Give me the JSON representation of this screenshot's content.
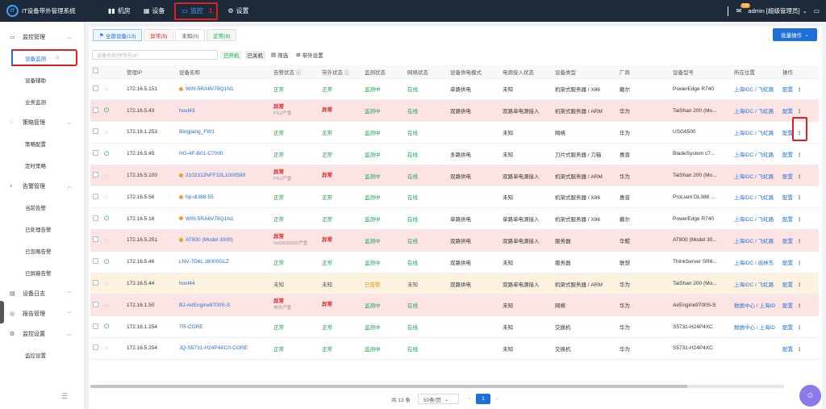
{
  "app": {
    "title": "IT设备带外管理系统",
    "logo_text": "IT"
  },
  "topnav": [
    {
      "label": "机房",
      "icon": "signal-bars-icon"
    },
    {
      "label": "设备",
      "icon": "grid-icon"
    },
    {
      "label": "监控",
      "icon": "monitor-icon",
      "active": true,
      "badge": "1"
    },
    {
      "label": "设置",
      "icon": "gear-icon"
    }
  ],
  "user": {
    "msg_count": "136",
    "name": "admin [超级管理员]"
  },
  "sidebar": {
    "groups": [
      {
        "label": "监控管理",
        "icon": "monitor-icon",
        "items": [
          {
            "label": "设备监测",
            "selected": true
          },
          {
            "label": "设备辅助"
          },
          {
            "label": "业务监测"
          }
        ]
      },
      {
        "label": "策略管理",
        "icon": "bulb-icon",
        "items": [
          {
            "label": "策略配置"
          },
          {
            "label": "定时策略"
          }
        ]
      },
      {
        "label": "告警管理",
        "icon": "bell-icon",
        "items": [
          {
            "label": "当前告警"
          },
          {
            "label": "已处理告警"
          },
          {
            "label": "已忽略告警"
          },
          {
            "label": "已屏蔽告警"
          }
        ]
      },
      {
        "label": "设备日志",
        "icon": "log-icon",
        "items": []
      },
      {
        "label": "报告管理",
        "icon": "report-icon",
        "items": []
      },
      {
        "label": "监控设置",
        "icon": "gear-icon",
        "items": [
          {
            "label": "监控设置"
          }
        ]
      }
    ]
  },
  "tabs": {
    "all": "全部设备(13)",
    "err": "异常(5)",
    "unk": "未知(0)",
    "ok": "正常(8)"
  },
  "batch_label": "批量操作",
  "filters": {
    "search_placeholder": "设备名称/序列号/IP",
    "on": "已开机",
    "off": "已关机",
    "filter": "筛选",
    "band": "带外设置"
  },
  "columns": [
    "管理IP",
    "设备名称",
    "告警状态",
    "带外状态",
    "监测状态",
    "网络状态",
    "设备供电模式",
    "电源接入状态",
    "设备类型",
    "厂商",
    "设备型号",
    "所在位置",
    "操作"
  ],
  "rows": [
    {
      "ip": "172.16.5.151",
      "name": "WIN-5RA6V78Q1N1",
      "dot": "#f0a030",
      "alarm": "正常",
      "alarm_sub": "",
      "band": "正常",
      "monitor": "监测中",
      "net": "在线",
      "supply": "单路供电",
      "power": "未知",
      "type": "机架式服务器 / X86",
      "vendor": "戴尔",
      "model": "PowerEdge R740",
      "loc": "上海IDC / 飞虹路",
      "power_on": false,
      "row": ""
    },
    {
      "ip": "172.16.5.43",
      "name": "host43",
      "dot": "",
      "alarm": "异常",
      "alarm_sub": "PSU严重",
      "band": "异常",
      "monitor": "监测中",
      "net": "在线",
      "supply": "双路供电",
      "power": "双路单电源接入",
      "type": "机架式服务器 / ARM",
      "vendor": "华为",
      "model": "TaiShan 200 (Mo...",
      "loc": "上海IDC / 飞虹路",
      "power_on": true,
      "row": "err"
    },
    {
      "ip": "172.16.1.253",
      "name": "Bingjiang_FW1",
      "dot": "",
      "alarm": "正常",
      "alarm_sub": "",
      "band": "正常",
      "monitor": "监测中",
      "net": "在线",
      "supply": "",
      "power": "未知",
      "type": "网络",
      "vendor": "华为",
      "model": "USG6500",
      "loc": "上海IDC / 飞虹路",
      "power_on": false,
      "row": ""
    },
    {
      "ip": "172.16.5.45",
      "name": "HG-4F-B01-C7000",
      "dot": "",
      "alarm": "正常",
      "alarm_sub": "",
      "band": "正常",
      "monitor": "监测中",
      "net": "在线",
      "supply": "多路供电",
      "power": "未知",
      "type": "刀片式服务器 / 刀箱",
      "vendor": "惠普",
      "model": "BladeSystem c7...",
      "loc": "上海IDC / 飞虹路",
      "power_on": true,
      "row": ""
    },
    {
      "ip": "172.16.5.100",
      "name": "2102312NFF10L1000589",
      "dot": "#f0a030",
      "alarm": "异常",
      "alarm_sub": "PSU严重",
      "band": "异常",
      "monitor": "监测中",
      "net": "在线",
      "supply": "双路供电",
      "power": "双路单电源接入",
      "type": "机架式服务器 / ARM",
      "vendor": "华为",
      "model": "TaiShan 200 (Mo...",
      "loc": "上海IDC / 飞虹路",
      "power_on": false,
      "row": "err"
    },
    {
      "ip": "172.16.5.56",
      "name": "hp-dl388-55",
      "dot": "#f0a030",
      "alarm": "正常",
      "alarm_sub": "",
      "band": "正常",
      "monitor": "监测中",
      "net": "在线",
      "supply": "",
      "power": "未知",
      "type": "机架式服务器 / X86",
      "vendor": "惠普",
      "model": "ProLiant DL388 ...",
      "loc": "上海IDC / 飞虹路",
      "power_on": false,
      "row": ""
    },
    {
      "ip": "172.16.5.16",
      "name": "WIN-5RA6V78Q1N1",
      "dot": "#f0a030",
      "alarm": "正常",
      "alarm_sub": "",
      "band": "正常",
      "monitor": "监测中",
      "net": "在线",
      "supply": "单路供电",
      "power": "单路单电源接入",
      "type": "机架式服务器 / X86",
      "vendor": "戴尔",
      "model": "PowerEdge R740",
      "loc": "上海IDC / 飞虹路",
      "power_on": true,
      "row": ""
    },
    {
      "ip": "172.16.5.251",
      "name": "AT800 (Model 3000)",
      "dot": "#f0a030",
      "alarm": "异常",
      "alarm_sub": "0x0300000D严重",
      "band": "异常",
      "monitor": "监测中",
      "net": "在线",
      "supply": "双路供电",
      "power": "双路单电源接入",
      "type": "服务器",
      "vendor": "华鲲",
      "model": "AT800 (Model 30...",
      "loc": "上海IDC / 飞虹路",
      "power_on": false,
      "row": "err"
    },
    {
      "ip": "172.16.5.46",
      "name": "LNV-7D6L J8000GLZ",
      "dot": "",
      "alarm": "正常",
      "alarm_sub": "",
      "band": "正常",
      "monitor": "监测中",
      "net": "在线",
      "supply": "双路供电",
      "power": "未知",
      "type": "服务器",
      "vendor": "联想",
      "model": "ThinkServer SR6...",
      "loc": "上海IDC / 庙林东",
      "power_on": true,
      "row": ""
    },
    {
      "ip": "172.16.5.44",
      "name": "host44",
      "dot": "",
      "alarm": "未知",
      "alarm_sub": "",
      "band": "未知",
      "monitor": "已告警",
      "net": "未知",
      "supply": "双路供电",
      "power": "双路单电源接入",
      "type": "机架式服务器 / ARM",
      "vendor": "华为",
      "model": "TaiShan 200 (Mo...",
      "loc": "上海IDC / 飞虹路",
      "power_on": false,
      "row": "warn"
    },
    {
      "ip": "172.16.1.50",
      "name": "BJ-AirEngine9700S-S",
      "dot": "",
      "alarm": "异常",
      "alarm_sub": "电热严重",
      "band": "异常",
      "monitor": "监测中",
      "net": "在线",
      "supply": "",
      "power": "未知",
      "type": "网络",
      "vendor": "华为",
      "model": "AirEngine9700S-S",
      "loc": "数据中心 / 上海ID",
      "power_on": false,
      "row": "err"
    },
    {
      "ip": "172.16.1.254",
      "name": "TR-CORE",
      "dot": "",
      "alarm": "正常",
      "alarm_sub": "",
      "band": "正常",
      "monitor": "监测中",
      "net": "在线",
      "supply": "",
      "power": "未知",
      "type": "交换机",
      "vendor": "华为",
      "model": "S5731-H24P4XC",
      "loc": "数据中心 / 上海ID",
      "power_on": true,
      "row": ""
    },
    {
      "ip": "172.16.5.254",
      "name": "JQ-S5731-H24P4XC0-CORE",
      "dot": "",
      "alarm": "正常",
      "alarm_sub": "",
      "band": "正常",
      "monitor": "监测中",
      "net": "在线",
      "supply": "",
      "power": "未知",
      "type": "交换机",
      "vendor": "华为",
      "model": "S5731-H24P4XC",
      "loc": "",
      "power_on": false,
      "row": ""
    }
  ],
  "row_action": {
    "config": "配置",
    "more": "⋮"
  },
  "pager": {
    "total": "共 13 条",
    "page_size": "50条/页",
    "current": "1",
    "prev": "‹",
    "next": "›"
  },
  "colors": {
    "primary": "#1e6fd9",
    "ok": "#19a04a",
    "error": "#e02020",
    "warn": "#f08a00",
    "topbar": "#1d2a3a"
  }
}
